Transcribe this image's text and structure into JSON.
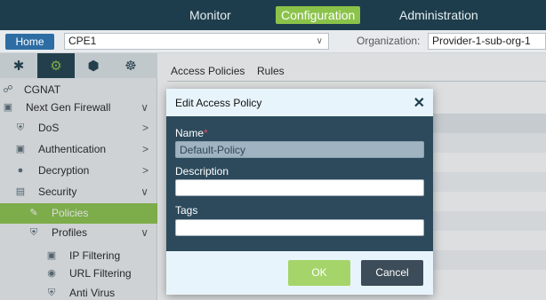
{
  "topnav": {
    "monitor": "Monitor",
    "configuration": "Configuration",
    "administration": "Administration"
  },
  "subbar": {
    "home": "Home",
    "device": "CPE1",
    "org_label": "Organization:",
    "org_value": "Provider-1-sub-org-1"
  },
  "sidebar": {
    "tabs": [
      "network-icon",
      "gear-icon",
      "cube-icon",
      "services-icon"
    ],
    "items": [
      {
        "label": "CGNAT",
        "icon": "network-icon"
      },
      {
        "label": "Next Gen Firewall",
        "icon": "firewall-icon",
        "arrow": "∨"
      },
      {
        "label": "DoS",
        "icon": "shield-icon",
        "arrow": ">"
      },
      {
        "label": "Authentication",
        "icon": "lock-icon",
        "arrow": ">"
      },
      {
        "label": "Decryption",
        "icon": "key-icon",
        "arrow": ">"
      },
      {
        "label": "Security",
        "icon": "wall-icon",
        "arrow": "∨"
      },
      {
        "label": "Policies",
        "icon": "policy-icon"
      },
      {
        "label": "Profiles",
        "icon": "shield-icon",
        "arrow": "∨"
      },
      {
        "label": "IP Filtering",
        "icon": "monitor-icon"
      },
      {
        "label": "URL Filtering",
        "icon": "globe-icon"
      },
      {
        "label": "Anti Virus",
        "icon": "virus-icon"
      }
    ]
  },
  "main": {
    "tabs": [
      "Access Policies",
      "Rules"
    ]
  },
  "modal": {
    "title": "Edit Access Policy",
    "name_label": "Name",
    "name_required": "*",
    "name_value": "Default-Policy",
    "description_label": "Description",
    "description_value": "",
    "tags_label": "Tags",
    "tags_value": "",
    "ok": "OK",
    "cancel": "Cancel"
  },
  "colors": {
    "topbar": "#1e3d4c",
    "accent": "#8bc34a",
    "modal_body": "#2c4a5c",
    "modal_header": "#e8f4fb"
  }
}
